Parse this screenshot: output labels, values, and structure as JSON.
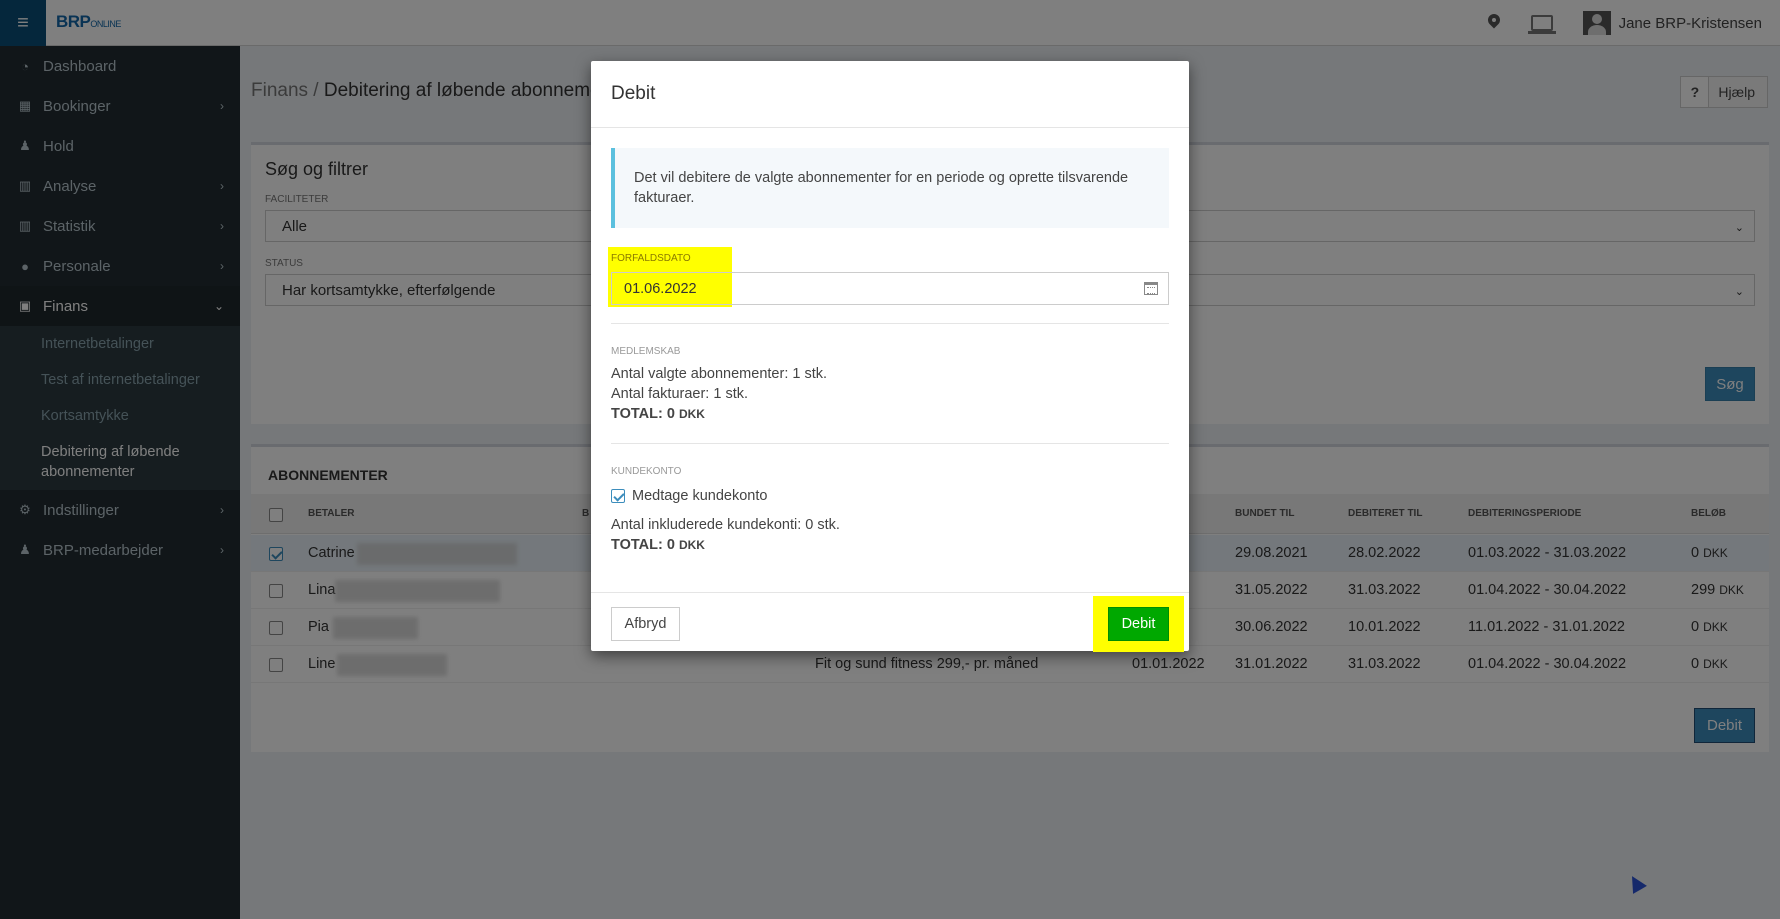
{
  "topbar": {
    "logo_main": "BRP",
    "logo_sub": "ONLINE",
    "user_name": "Jane BRP-Kristensen"
  },
  "sidebar": {
    "items": [
      {
        "label": "Dashboard",
        "icon": "dashboard-icon"
      },
      {
        "label": "Bookinger",
        "icon": "calendar-icon"
      },
      {
        "label": "Hold",
        "icon": "person-icon"
      },
      {
        "label": "Analyse",
        "icon": "bar-chart-icon"
      },
      {
        "label": "Statistik",
        "icon": "bar-chart-icon"
      },
      {
        "label": "Personale",
        "icon": "user-icon"
      },
      {
        "label": "Finans",
        "icon": "money-icon"
      },
      {
        "label": "Indstillinger",
        "icon": "gear-icon"
      },
      {
        "label": "BRP-medarbejder",
        "icon": "person-icon"
      }
    ],
    "finans_sub": [
      "Internetbetalinger",
      "Test af internetbetalinger",
      "Kortsamtykke",
      "Debitering af løbende abonnementer"
    ]
  },
  "page": {
    "crumb_parent": "Finans",
    "crumb_sep": " / ",
    "crumb_current": "Debitering af løbende abonnementer",
    "help_q": "?",
    "help_label": "Hjælp"
  },
  "filter": {
    "title": "Søg og filtrer",
    "facilities_label": "FACILITETER",
    "facilities_value": "Alle",
    "status_label": "STATUS",
    "status_value": "Har kortsamtykke, efterfølgende",
    "search_label": "Søg"
  },
  "subscriptions": {
    "title": "ABONNEMENTER",
    "headers": {
      "payer": "BETALER",
      "b": "B",
      "bound_to": "BUNDET TIL",
      "debited_to": "DEBITERET TIL",
      "period": "DEBITERINGSPERIODE",
      "amount": "BELØB"
    },
    "rows": [
      {
        "payer": "Catrine",
        "start": "",
        "bound_to": "29.08.2021",
        "debited_to": "28.02.2022",
        "period": "01.03.2022 - 31.03.2022",
        "amount": "0",
        "currency": "DKK",
        "checked": true
      },
      {
        "payer": "Lina",
        "start": "",
        "bound_to": "31.05.2022",
        "debited_to": "31.03.2022",
        "period": "01.04.2022 - 30.04.2022",
        "amount": "299",
        "currency": "DKK",
        "checked": false
      },
      {
        "payer": "Pia",
        "start": "",
        "bound_to": "30.06.2022",
        "debited_to": "10.01.2022",
        "period": "11.01.2022 - 31.01.2022",
        "amount": "0",
        "currency": "DKK",
        "checked": false
      },
      {
        "payer": "Line",
        "product": "Fit og sund fitness 299,- pr. måned",
        "start": "01.01.2022",
        "bound_to": "31.01.2022",
        "debited_to": "31.03.2022",
        "period": "01.04.2022 - 30.04.2022",
        "amount": "0",
        "currency": "DKK",
        "checked": false
      }
    ],
    "debit_label": "Debit"
  },
  "modal": {
    "title": "Debit",
    "info": "Det vil debitere de valgte abonnementer for en periode og oprette tilsvarende fakturaer.",
    "due_label": "FORFALDSDATO",
    "due_value": "01.06.2022",
    "membership_label": "MEDLEMSKAB",
    "selected_count": "Antal valgte abonnementer: 1 stk.",
    "invoice_count": "Antal fakturaer: 1 stk.",
    "membership_total": "TOTAL: 0",
    "currency": "DKK",
    "account_label": "KUNDEKONTO",
    "include_account": "Medtage kundekonto",
    "included_accounts": "Antal inkluderede kundekonti: 0 stk.",
    "account_total": "TOTAL: 0",
    "cancel_label": "Afbryd",
    "debit_label": "Debit"
  }
}
